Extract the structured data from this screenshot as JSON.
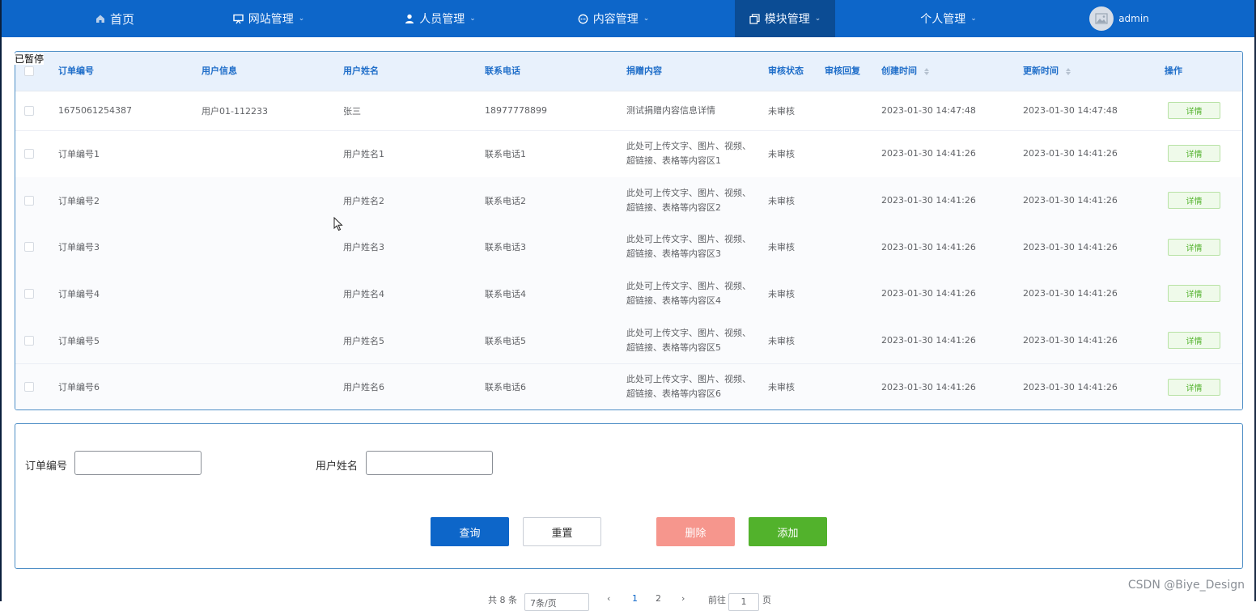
{
  "nav": {
    "items": [
      {
        "label": "首页",
        "icon": "home-icon",
        "dropdown": false
      },
      {
        "label": "网站管理",
        "icon": "monitor-icon",
        "dropdown": true
      },
      {
        "label": "人员管理",
        "icon": "user-icon",
        "dropdown": true
      },
      {
        "label": "内容管理",
        "icon": "chat-icon",
        "dropdown": true
      },
      {
        "label": "模块管理",
        "icon": "module-icon",
        "dropdown": true,
        "active": true
      },
      {
        "label": "个人管理",
        "icon": "",
        "dropdown": true
      }
    ],
    "user_name": "admin"
  },
  "overlay": {
    "paused_label": "已暂停"
  },
  "table": {
    "columns": [
      "订单编号",
      "用户信息",
      "用户姓名",
      "联系电话",
      "捐赠内容",
      "审核状态",
      "审核回复",
      "创建时间",
      "更新时间",
      "操作"
    ],
    "rows": [
      {
        "order_no": "1675061254387",
        "user_info": "用户01-112233",
        "user_name": "张三",
        "phone": "18977778899",
        "content": "测试捐赠内容信息详情",
        "status": "未审核",
        "reply": "",
        "created": "2023-01-30 14:47:48",
        "updated": "2023-01-30 14:47:48",
        "action": "详情"
      },
      {
        "order_no": "订单编号1",
        "user_info": "",
        "user_name": "用户姓名1",
        "phone": "联系电话1",
        "content": "此处可上传文字、图片、视频、超链接、表格等内容区1",
        "status": "未审核",
        "reply": "",
        "created": "2023-01-30 14:41:26",
        "updated": "2023-01-30 14:41:26",
        "action": "详情"
      },
      {
        "order_no": "订单编号2",
        "user_info": "",
        "user_name": "用户姓名2",
        "phone": "联系电话2",
        "content": "此处可上传文字、图片、视频、超链接、表格等内容区2",
        "status": "未审核",
        "reply": "",
        "created": "2023-01-30 14:41:26",
        "updated": "2023-01-30 14:41:26",
        "action": "详情"
      },
      {
        "order_no": "订单编号3",
        "user_info": "",
        "user_name": "用户姓名3",
        "phone": "联系电话3",
        "content": "此处可上传文字、图片、视频、超链接、表格等内容区3",
        "status": "未审核",
        "reply": "",
        "created": "2023-01-30 14:41:26",
        "updated": "2023-01-30 14:41:26",
        "action": "详情"
      },
      {
        "order_no": "订单编号4",
        "user_info": "",
        "user_name": "用户姓名4",
        "phone": "联系电话4",
        "content": "此处可上传文字、图片、视频、超链接、表格等内容区4",
        "status": "未审核",
        "reply": "",
        "created": "2023-01-30 14:41:26",
        "updated": "2023-01-30 14:41:26",
        "action": "详情"
      },
      {
        "order_no": "订单编号5",
        "user_info": "",
        "user_name": "用户姓名5",
        "phone": "联系电话5",
        "content": "此处可上传文字、图片、视频、超链接、表格等内容区5",
        "status": "未审核",
        "reply": "",
        "created": "2023-01-30 14:41:26",
        "updated": "2023-01-30 14:41:26",
        "action": "详情"
      },
      {
        "order_no": "订单编号6",
        "user_info": "",
        "user_name": "用户姓名6",
        "phone": "联系电话6",
        "content": "此处可上传文字、图片、视频、超链接、表格等内容区6",
        "status": "未审核",
        "reply": "",
        "created": "2023-01-30 14:41:26",
        "updated": "2023-01-30 14:41:26",
        "action": "详情"
      }
    ]
  },
  "search": {
    "order_label": "订单编号",
    "order_value": "",
    "name_label": "用户姓名",
    "name_value": "",
    "query_label": "查询",
    "reset_label": "重置",
    "delete_label": "删除",
    "add_label": "添加"
  },
  "pagination": {
    "total_text": "共 8 条",
    "page_size_text": "7条/页",
    "prev": "‹",
    "pages": [
      "1",
      "2"
    ],
    "next": "›",
    "goto_label": "前往",
    "goto_value": "1",
    "page_unit": "页"
  },
  "watermark": "CSDN @Biye_Design",
  "colors": {
    "primary": "#0d66c9",
    "nav_active": "#0b4c94",
    "success": "#52b22c",
    "danger_light": "#f6968d",
    "header_text": "#1f6ec9"
  }
}
